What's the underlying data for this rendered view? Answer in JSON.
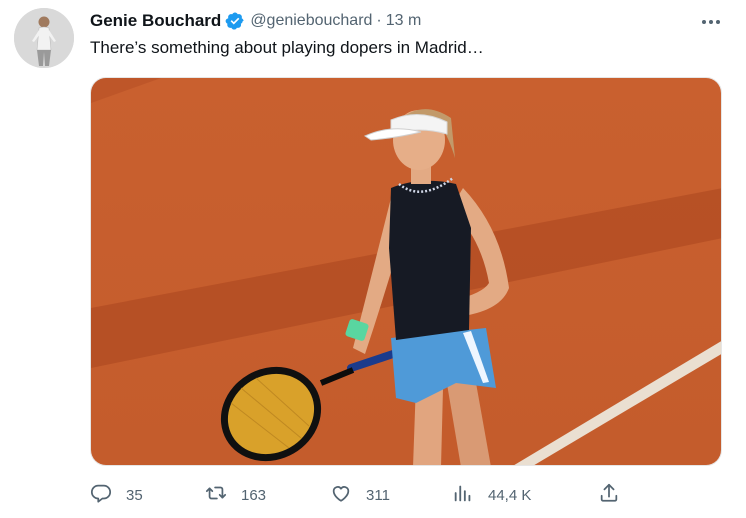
{
  "tweet": {
    "display_name": "Genie Bouchard",
    "handle": "@geniebouchard",
    "separator": "·",
    "time": "13 m",
    "text": "There’s something about playing dopers in Madrid…",
    "actions": {
      "replies": "35",
      "retweets": "163",
      "likes": "311",
      "views": "44,4 K"
    }
  },
  "icons": {
    "verified": "verified-badge-icon",
    "more": "more-horizontal-icon",
    "reply": "reply-icon",
    "retweet": "retweet-icon",
    "like": "heart-icon",
    "views": "views-icon",
    "share": "share-icon"
  },
  "colors": {
    "verified_blue": "#1d9bf0",
    "secondary_text": "#536471",
    "primary_text": "#0f1419",
    "clay": "#c8602f"
  }
}
